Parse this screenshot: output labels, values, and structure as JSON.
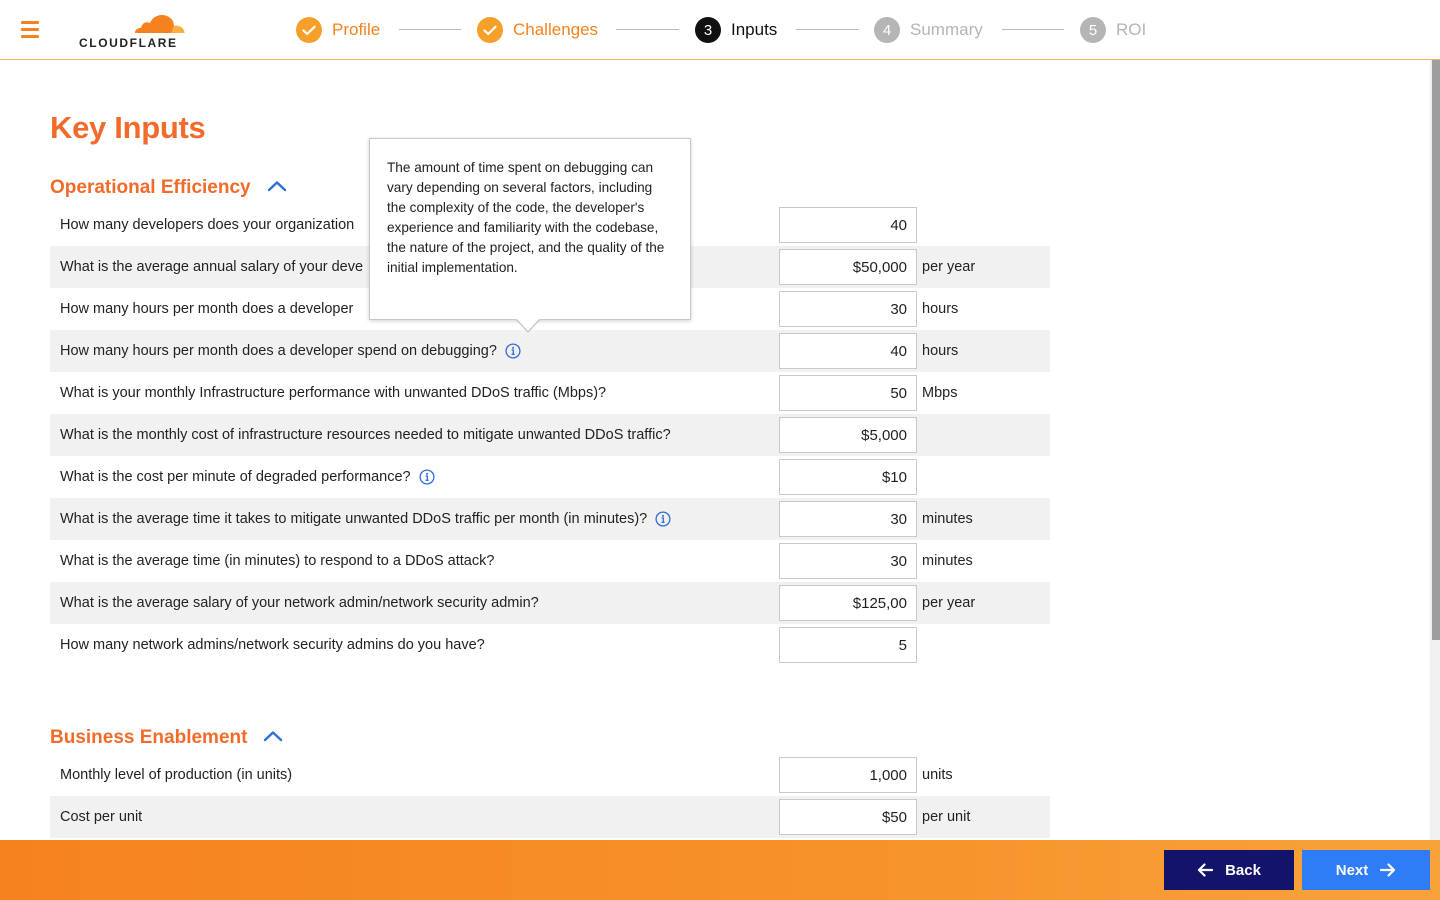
{
  "header": {
    "logo_text": "CLOUDFLARE",
    "steps": [
      {
        "number": "1",
        "label": "Profile",
        "state": "done"
      },
      {
        "number": "2",
        "label": "Challenges",
        "state": "done"
      },
      {
        "number": "3",
        "label": "Inputs",
        "state": "active"
      },
      {
        "number": "4",
        "label": "Summary",
        "state": "future"
      },
      {
        "number": "5",
        "label": "ROI",
        "state": "future"
      }
    ]
  },
  "page": {
    "title": "Key Inputs"
  },
  "sections": {
    "operational": {
      "title": "Operational Efficiency",
      "rows": [
        {
          "question": "How many developers does your organization",
          "value": "40",
          "unit": ""
        },
        {
          "question": "What is the average annual salary of your deve",
          "value": "$50,000",
          "unit": "per year"
        },
        {
          "question": "How many hours per month does a developer",
          "value": "30",
          "unit": "hours"
        },
        {
          "question": "How many hours per month does a developer spend on debugging?",
          "value": "40",
          "unit": "hours"
        },
        {
          "question": "What is your monthly Infrastructure performance with unwanted DDoS traffic (Mbps)?",
          "value": "50",
          "unit": "Mbps"
        },
        {
          "question": "What is the monthly cost of infrastructure resources needed to mitigate unwanted DDoS traffic?",
          "value": "$5,000",
          "unit": ""
        },
        {
          "question": "What is the cost per minute of degraded performance?",
          "value": "$10",
          "unit": ""
        },
        {
          "question": "What is the average time it takes to mitigate unwanted DDoS traffic per month (in minutes)?",
          "value": "30",
          "unit": "minutes"
        },
        {
          "question": "What is the average time (in minutes) to respond to a DDoS attack?",
          "value": "30",
          "unit": "minutes"
        },
        {
          "question": "What is the average salary of your network admin/network security admin?",
          "value": "$125,00",
          "unit": "per year"
        },
        {
          "question": "How many network admins/network security admins do you have?",
          "value": "5",
          "unit": ""
        }
      ]
    },
    "business": {
      "title": "Business Enablement",
      "rows": [
        {
          "question": "Monthly level of production (in units)",
          "value": "1,000",
          "unit": "units"
        },
        {
          "question": "Cost per unit",
          "value": "$50",
          "unit": "per unit"
        }
      ]
    }
  },
  "tooltip": {
    "text": "The amount of time spent on debugging can vary depending on several factors, including the complexity of the code, the developer's experience and familiarity with the codebase, the nature of the project, and the quality of the initial implementation."
  },
  "footer": {
    "back_label": "Back",
    "next_label": "Next"
  },
  "colors": {
    "brand_orange": "#f26b2a",
    "step_done": "#f6a02b",
    "back_button": "#14136b",
    "next_button": "#2e7cf6",
    "info_icon": "#2e6fd8"
  }
}
